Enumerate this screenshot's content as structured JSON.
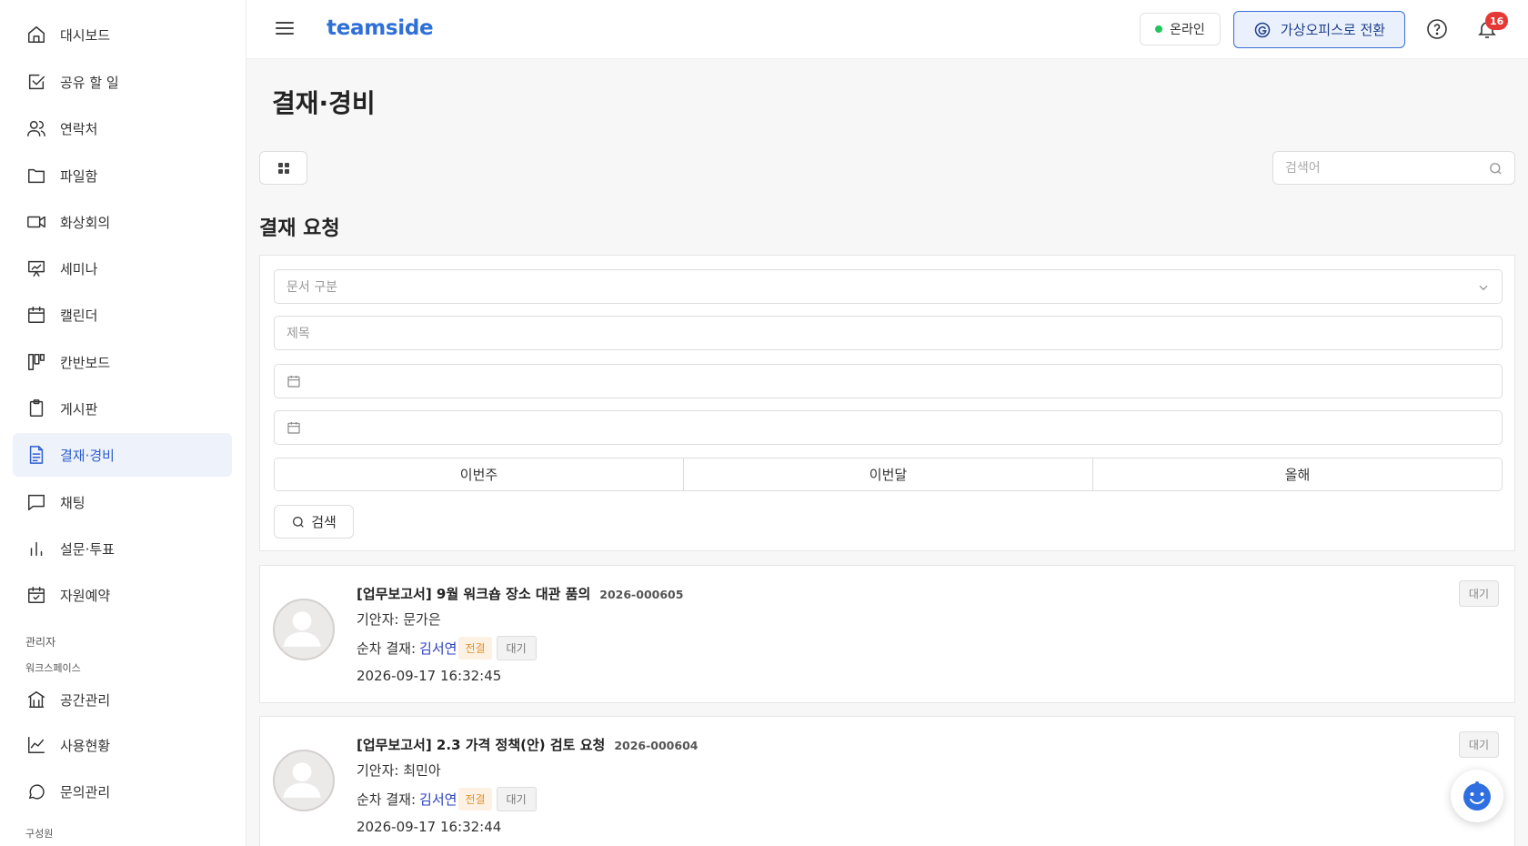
{
  "sidebar": {
    "items": [
      {
        "label": "대시보드",
        "icon": "home-icon"
      },
      {
        "label": "공유 할 일",
        "icon": "checkbox-icon"
      },
      {
        "label": "연락처",
        "icon": "users-icon"
      },
      {
        "label": "파일함",
        "icon": "folder-icon"
      },
      {
        "label": "화상회의",
        "icon": "video-icon"
      },
      {
        "label": "세미나",
        "icon": "presentation-icon"
      },
      {
        "label": "캘린더",
        "icon": "calendar-icon"
      },
      {
        "label": "칸반보드",
        "icon": "kanban-icon"
      },
      {
        "label": "게시판",
        "icon": "clipboard-icon"
      },
      {
        "label": "결재·경비",
        "icon": "document-icon",
        "active": true
      },
      {
        "label": "채팅",
        "icon": "chat-icon"
      },
      {
        "label": "설문·투표",
        "icon": "bar-chart-icon"
      },
      {
        "label": "자원예약",
        "icon": "calendar-check-icon"
      }
    ],
    "admin_label": "관리자",
    "workspace_label": "워크스페이스",
    "admin_items": [
      {
        "label": "공간관리",
        "icon": "building-icon"
      },
      {
        "label": "사용현황",
        "icon": "line-chart-icon"
      },
      {
        "label": "문의관리",
        "icon": "message-circle-icon"
      }
    ],
    "member_label": "구성원"
  },
  "topbar": {
    "brand": "teamside",
    "status": "온라인",
    "virtual_office_label": "가상오피스로 전환",
    "notification_count": "16"
  },
  "main": {
    "title": "결재·경비",
    "search_placeholder": "검색어",
    "section_title": "결재 요청",
    "filter": {
      "doc_type_placeholder": "문서 구분",
      "title_placeholder": "제목",
      "range_buttons": [
        "이번주",
        "이번달",
        "올해"
      ],
      "search_label": "검색"
    },
    "documents": [
      {
        "title": "[업무보고서] 9월 워크숍 장소 대관 품의",
        "number": "2026-000605",
        "drafter": "기안자: 문가은",
        "seq_label": "순차 결재:",
        "approver": "김서연",
        "tag1": "전결",
        "tag2": "대기",
        "date": "2026-09-17 16:32:45",
        "status": "대기"
      },
      {
        "title": "[업무보고서] 2.3 가격 정책(안) 검토 요청",
        "number": "2026-000604",
        "drafter": "기안자: 최민아",
        "seq_label": "순차 결재:",
        "approver": "김서연",
        "tag1": "전결",
        "tag2": "대기",
        "date": "2026-09-17 16:32:44",
        "status": "대기"
      }
    ]
  },
  "colors": {
    "brand": "#2f6fd8",
    "active_bg": "#eef2fb",
    "online": "#22c55e",
    "badge": "#e53935",
    "approver": "#2a3fbf",
    "tag_jeon": "#e0922f"
  }
}
